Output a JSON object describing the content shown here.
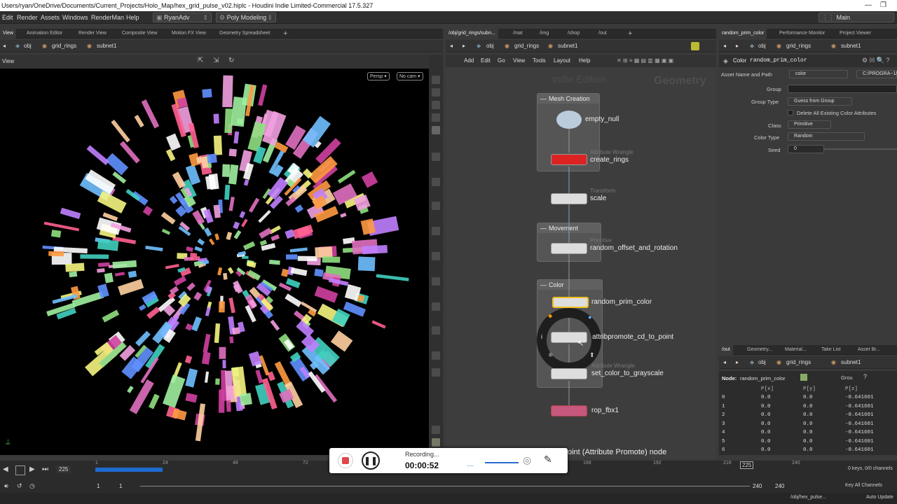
{
  "title_path": "Users/ryan/OneDrive/Documents/Current_Projects/Holo_Map/hex_grid_pulse_v02.hiplc - Houdini Indie Limited-Commercial 17.5.327",
  "window_controls": {
    "minimize": "—",
    "restore": "❐"
  },
  "menus": [
    "Edit",
    "Render",
    "Assets",
    "Windows",
    "RenderMan",
    "Help"
  ],
  "desktop_dropdown": "RyanAdv",
  "shelf_dropdown": "Poly Modeling",
  "main_label": "Main",
  "left_tabs": [
    "View",
    "Animation Editor",
    "Render View",
    "Composite View",
    "Motion FX View",
    "Geometry Spreadsheet"
  ],
  "left_path": [
    "obj",
    "grid_rings",
    "subnet1"
  ],
  "viewport": {
    "label": "View",
    "persp": "Persp ▾",
    "cam": "No cam ▾"
  },
  "mid_tabs": [
    "/obj/grid_rings/subn...",
    "/mat",
    "/img",
    "/shop",
    "/out"
  ],
  "mid_path": [
    "obj",
    "grid_rings",
    "subnet1"
  ],
  "net_menus": [
    "Add",
    "Edit",
    "Go",
    "View",
    "Tools",
    "Layout",
    "Help"
  ],
  "net_watermark": {
    "left": "Indie Edition",
    "right": "Geometry"
  },
  "network_boxes": [
    {
      "title": "Mesh Creation"
    },
    {
      "title": "Movement"
    },
    {
      "title": "Color"
    }
  ],
  "nodes": [
    {
      "name": "empty_null",
      "type": ""
    },
    {
      "name": "create_rings",
      "type": "Attribute Wrangle"
    },
    {
      "name": "scale",
      "type": "Transform"
    },
    {
      "name": "random_offset_and_rotation",
      "type": "Primitive"
    },
    {
      "name": "random_prim_color",
      "type": ""
    },
    {
      "name": "attribpromote_cd_to_point",
      "type": ""
    },
    {
      "name": "set_color_to_grayscale",
      "type": "Attribute Wrangle"
    },
    {
      "name": "rop_fbx1",
      "type": ""
    }
  ],
  "tooltip": "oint (Attribute Promote) node",
  "right_tabs": [
    "random_prim_color",
    "Performance Monitor",
    "Project Viewer"
  ],
  "right_path": [
    "obj",
    "grid_rings",
    "subnet1"
  ],
  "params": {
    "node_type": "Color",
    "node_name": "random_prim_color",
    "asset_label": "Asset Name and Path",
    "asset_value": "color",
    "asset_path": "C:/PROGRA~1/",
    "group_label": "Group",
    "group_type_label": "Group Type",
    "group_type_value": "Guess from Group",
    "delete_label": "Delete All Existing Color Attributes",
    "class_label": "Class",
    "class_value": "Primitive",
    "color_type_label": "Color Type",
    "color_type_value": "Random",
    "seed_label": "Seed",
    "seed_value": "0"
  },
  "bottom_tabs": [
    "/out",
    "Geometry...",
    "Material...",
    "Take List",
    "Asset Br..."
  ],
  "bottom_path": [
    "obj",
    "grid_rings",
    "subnet1"
  ],
  "spreadsheet": {
    "node_label": "Node:",
    "node_name": "random_prim_color",
    "group_label": "Grou",
    "columns": [
      "",
      "P[x]",
      "P[y]",
      "P[z]"
    ],
    "rows": [
      [
        "0",
        "0.0",
        "0.0",
        "-0.641601"
      ],
      [
        "1",
        "0.0",
        "0.0",
        "-0.641601"
      ],
      [
        "2",
        "0.0",
        "0.0",
        "-0.641601"
      ],
      [
        "3",
        "0.0",
        "0.0",
        "-0.641601"
      ],
      [
        "4",
        "0.0",
        "0.0",
        "-0.641601"
      ],
      [
        "5",
        "0.0",
        "0.0",
        "-0.641601"
      ],
      [
        "6",
        "0.0",
        "0.0",
        "-0.641601"
      ]
    ]
  },
  "timeline": {
    "current_frame": "225",
    "ticks": [
      "1",
      "24",
      "48",
      "72",
      "168",
      "192",
      "216",
      "240"
    ],
    "range_start": "1",
    "range_start2": "1",
    "range_end": "240",
    "range_end2": "240",
    "keys_label": "0 keys, 0/0 channels",
    "key_all_label": "Key All Channels"
  },
  "recording": {
    "status": "Recording...",
    "time": "00:00:52"
  },
  "status_bar": {
    "path": "/obj/hex_pulse...",
    "auto_update": "Auto Update"
  }
}
